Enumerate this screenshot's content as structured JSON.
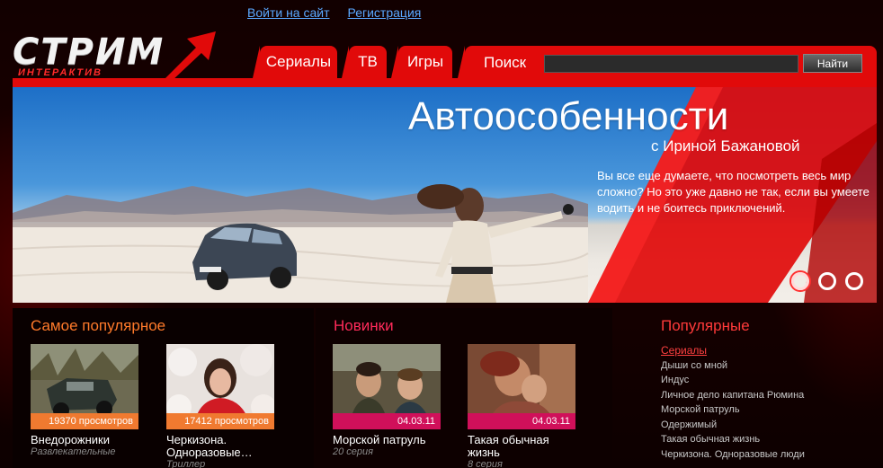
{
  "header": {
    "login_link": "Войти на сайт",
    "register_link": "Регистрация",
    "logo_text": "СТРИМ",
    "logo_subtext": "ИНТЕРАКТИВ"
  },
  "nav": {
    "tabs": [
      {
        "label": "Сериалы"
      },
      {
        "label": "ТВ"
      },
      {
        "label": "Игры"
      }
    ],
    "search_label": "Поиск",
    "search_value": "",
    "search_button": "Найти"
  },
  "banner": {
    "title": "Автоособенности",
    "subtitle": "с Ириной Бажановой",
    "description": "Вы все еще думаете, что посмотреть весь мир сложно? Но это уже давно не так, если вы умеете водить и не боитесь приключений.",
    "slides_total": 3,
    "active_slide": 1
  },
  "popular_now": {
    "title": "Самое популярное",
    "items": [
      {
        "badge": "19370 просмотров",
        "title": "Внедорожники",
        "subtitle": "Развлекательные"
      },
      {
        "badge": "17412 просмотров",
        "title": "Черкизона. Одноразовые…",
        "subtitle": "Триллер"
      }
    ]
  },
  "new_items": {
    "title": "Новинки",
    "items": [
      {
        "badge": "04.03.11",
        "title": "Морской патруль",
        "subtitle": "20 серия"
      },
      {
        "badge": "04.03.11",
        "title": "Такая обычная жизнь",
        "subtitle": "8 серия"
      }
    ]
  },
  "popular_list": {
    "title": "Популярные",
    "items": [
      {
        "label": "Сериалы",
        "active": true
      },
      {
        "label": "Дыши со мной"
      },
      {
        "label": "Индус"
      },
      {
        "label": "Личное дело капитана Рюмина"
      },
      {
        "label": "Морской патруль"
      },
      {
        "label": "Одержимый"
      },
      {
        "label": "Такая обычная жизнь"
      },
      {
        "label": "Черкизона. Одноразовые люди"
      }
    ]
  },
  "colors": {
    "accent_red": "#e10a0a",
    "link_blue": "#5aa8ff",
    "orange": "#f07a30",
    "pink": "#d0105a"
  }
}
